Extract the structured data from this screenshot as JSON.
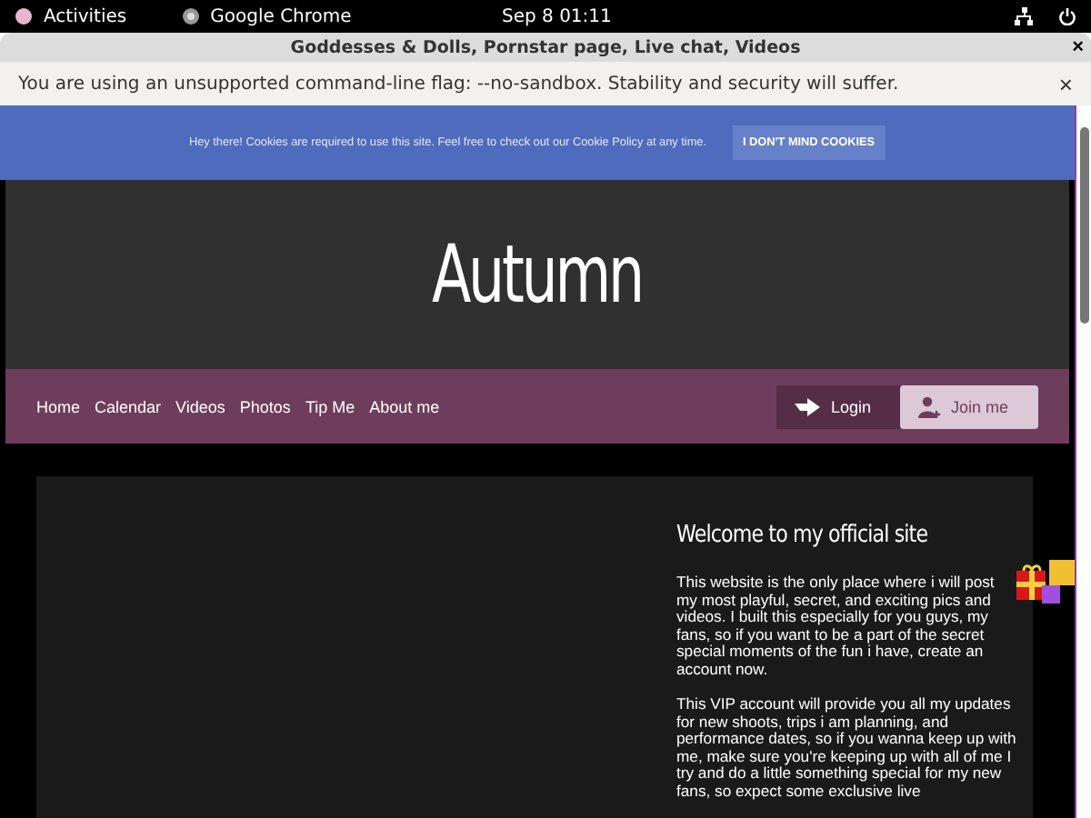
{
  "top_bar": {
    "activities": "Activities",
    "app": "Google Chrome",
    "clock": "Sep 8  01:11"
  },
  "window": {
    "title": "Goddesses & Dolls, Pornstar page, Live chat, Videos",
    "close": "×"
  },
  "infobar": {
    "text": "You are using an unsupported command-line flag: --no-sandbox. Stability and security will suffer.",
    "close": "×"
  },
  "cookie_banner": {
    "text": "Hey there! Cookies are required to use this site. Feel free to check out our Cookie Policy at any time.",
    "button": "I DON'T MIND COOKIES"
  },
  "header": {
    "title": "Autumn"
  },
  "nav": {
    "items": [
      "Home",
      "Calendar",
      "Videos",
      "Photos",
      "Tip Me",
      "About me"
    ],
    "login": "Login",
    "join": "Join me"
  },
  "content": {
    "heading": "Welcome to my official site",
    "paragraphs": [
      "This website is the only place where i will post my most playful, secret, and exciting pics and videos. I built this especially for you guys, my fans, so if you want to be a part of the secret special moments of the fun i have, create an account now.",
      "This VIP account will provide you all my updates for new shoots, trips i am planning, and performance dates, so if you wanna keep up with me, make sure you're keeping up with all of me I try and do a little something special for my new fans, so expect some exclusive live"
    ]
  }
}
